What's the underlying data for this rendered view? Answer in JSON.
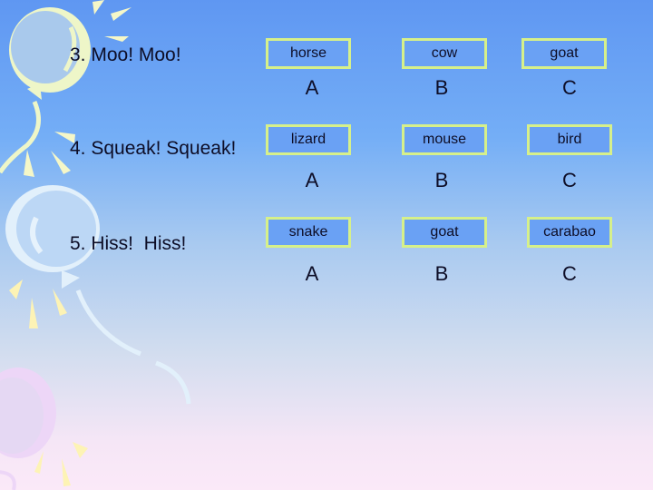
{
  "questions": [
    {
      "prompt": "3. Moo! Moo!",
      "options": [
        {
          "text": "horse",
          "letter": "A"
        },
        {
          "text": "cow",
          "letter": "B"
        },
        {
          "text": "goat",
          "letter": "C"
        }
      ]
    },
    {
      "prompt": "4. Squeak! Squeak!",
      "options": [
        {
          "text": "lizard",
          "letter": "A"
        },
        {
          "text": "mouse",
          "letter": "B"
        },
        {
          "text": "bird",
          "letter": "C"
        }
      ]
    },
    {
      "prompt": "5. Hiss!  Hiss!",
      "options": [
        {
          "text": "snake",
          "letter": "A"
        },
        {
          "text": "goat",
          "letter": "B"
        },
        {
          "text": "carabao",
          "letter": "C"
        }
      ]
    }
  ],
  "colors": {
    "box_border": "#d6f08a",
    "box_fill": "#6aa1f4",
    "text": "#0d0d26"
  }
}
